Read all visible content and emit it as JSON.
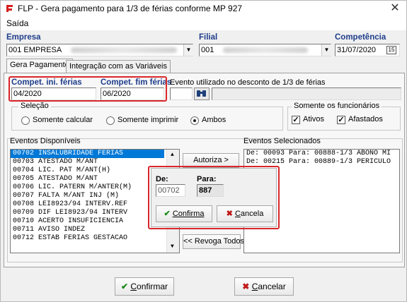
{
  "window": {
    "title": "FLP - Gera pagamento para 1/3 de férias conforme MP 927",
    "close_glyph": "✕"
  },
  "menu": {
    "items": [
      "Saída"
    ]
  },
  "header": {
    "empresa": {
      "label": "Empresa",
      "value": "001 EMPRESA"
    },
    "filial": {
      "label": "Filial",
      "value": "001"
    },
    "competencia": {
      "label": "Competência",
      "value": "31/07/2020",
      "calendar_glyph": "15"
    }
  },
  "tabs": [
    {
      "label": "Gera Pagamento",
      "active": true
    },
    {
      "label": "Integração com as Variáveis",
      "active": false
    }
  ],
  "compet": {
    "ini_label": "Compet. ini. férias",
    "ini_value": "04/2020",
    "fim_label": "Compet. fim férias",
    "fim_value": "06/2020"
  },
  "evento_desconto": {
    "label": "Evento utilizado no desconto de 1/3 de férias",
    "value": ""
  },
  "selecao": {
    "title": "Seleção",
    "options": [
      {
        "label": "Somente calcular",
        "selected": false
      },
      {
        "label": "Somente imprimir",
        "selected": false
      },
      {
        "label": "Ambos",
        "selected": true
      }
    ]
  },
  "funcionarios": {
    "title": "Somente os funcionários",
    "options": [
      {
        "label": "Ativos",
        "checked": true
      },
      {
        "label": "Afastados",
        "checked": true
      }
    ]
  },
  "eventos_disponiveis": {
    "label": "Eventos Disponíveis",
    "items": [
      "00702 INSALUBRIDADE FERIAS",
      "00703 ATESTADO M/ANT",
      "00704 LIC. PAT M/ANT(H)",
      "00705 ATESTADO M/ANT",
      "00706 LIC. PATERN M/ANTER(M)",
      "00707 FALTA M/ANT INJ (M)",
      "00708 LEI8923/94 INTERV.REF",
      "00709 DIF LEI8923/94 INTERV",
      "00710 ACERTO INSUFICIENCIA",
      "00711 AVISO INDEZ",
      "00712 ESTAB FERIAS GESTACAO"
    ],
    "selected_index": 0
  },
  "eventos_selecionados": {
    "label": "Eventos Selecionados",
    "items": [
      "De: 00093 Para: 00888-1/3 ABONO MI",
      "De: 00215 Para: 00889-1/3 PERICULO"
    ]
  },
  "autoriza_button": "Autoriza >",
  "revoga_button": "<< Revoga Todos",
  "popup": {
    "de_label": "De:",
    "de_value": "00702",
    "para_label": "Para:",
    "para_value": "887",
    "confirma_label": "Confirma",
    "cancela_label": "Cancela"
  },
  "footer": {
    "confirmar_label": "Confirmar",
    "cancelar_label": "Cancelar"
  },
  "colors": {
    "accent_blue": "#1f3d8a",
    "selection": "#0078d7",
    "highlight_red": "#d9262a",
    "confirm_green": "#1a8a1a"
  }
}
